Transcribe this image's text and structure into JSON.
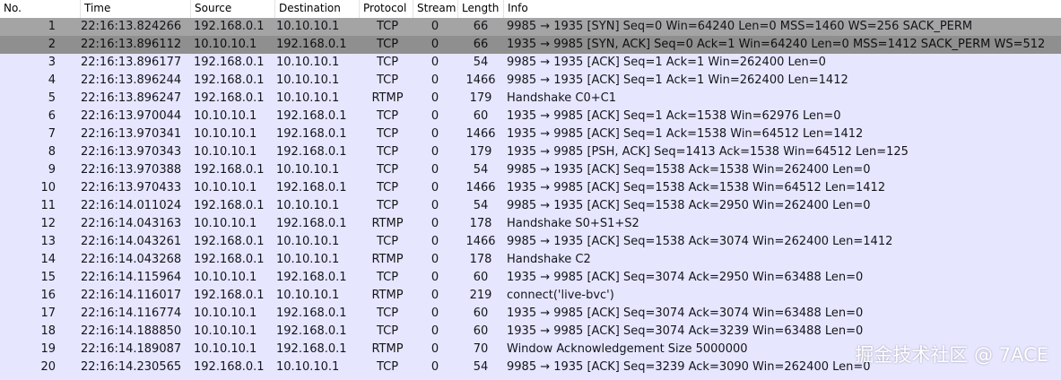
{
  "columns": {
    "no": "No.",
    "time": "Time",
    "source": "Source",
    "destination": "Destination",
    "protocol": "Protocol",
    "stream": "Stream",
    "length": "Length",
    "info": "Info"
  },
  "colors": {
    "row_background": "#e7e6ff",
    "selected_primary": "#a4a4a4",
    "selected_secondary": "#8f8f8f"
  },
  "packets": [
    {
      "no": "1",
      "time": "22:16:13.824266",
      "src": "192.168.0.1",
      "dst": "10.10.10.1",
      "proto": "TCP",
      "stream": "0",
      "len": "66",
      "info": "9985 → 1935 [SYN] Seq=0 Win=64240 Len=0 MSS=1460 WS=256 SACK_PERM"
    },
    {
      "no": "2",
      "time": "22:16:13.896112",
      "src": "10.10.10.1",
      "dst": "192.168.0.1",
      "proto": "TCP",
      "stream": "0",
      "len": "66",
      "info": "1935 → 9985 [SYN, ACK] Seq=0 Ack=1 Win=64240 Len=0 MSS=1412 SACK_PERM WS=512"
    },
    {
      "no": "3",
      "time": "22:16:13.896177",
      "src": "192.168.0.1",
      "dst": "10.10.10.1",
      "proto": "TCP",
      "stream": "0",
      "len": "54",
      "info": "9985 → 1935 [ACK] Seq=1 Ack=1 Win=262400 Len=0"
    },
    {
      "no": "4",
      "time": "22:16:13.896244",
      "src": "192.168.0.1",
      "dst": "10.10.10.1",
      "proto": "TCP",
      "stream": "0",
      "len": "1466",
      "info": "9985 → 1935 [ACK] Seq=1 Ack=1 Win=262400 Len=1412"
    },
    {
      "no": "5",
      "time": "22:16:13.896247",
      "src": "192.168.0.1",
      "dst": "10.10.10.1",
      "proto": "RTMP",
      "stream": "0",
      "len": "179",
      "info": "Handshake C0+C1"
    },
    {
      "no": "6",
      "time": "22:16:13.970044",
      "src": "10.10.10.1",
      "dst": "192.168.0.1",
      "proto": "TCP",
      "stream": "0",
      "len": "60",
      "info": "1935 → 9985 [ACK] Seq=1 Ack=1538 Win=62976 Len=0"
    },
    {
      "no": "7",
      "time": "22:16:13.970341",
      "src": "10.10.10.1",
      "dst": "192.168.0.1",
      "proto": "TCP",
      "stream": "0",
      "len": "1466",
      "info": "1935 → 9985 [ACK] Seq=1 Ack=1538 Win=64512 Len=1412"
    },
    {
      "no": "8",
      "time": "22:16:13.970343",
      "src": "10.10.10.1",
      "dst": "192.168.0.1",
      "proto": "TCP",
      "stream": "0",
      "len": "179",
      "info": "1935 → 9985 [PSH, ACK] Seq=1413 Ack=1538 Win=64512 Len=125"
    },
    {
      "no": "9",
      "time": "22:16:13.970388",
      "src": "192.168.0.1",
      "dst": "10.10.10.1",
      "proto": "TCP",
      "stream": "0",
      "len": "54",
      "info": "9985 → 1935 [ACK] Seq=1538 Ack=1538 Win=262400 Len=0"
    },
    {
      "no": "10",
      "time": "22:16:13.970433",
      "src": "10.10.10.1",
      "dst": "192.168.0.1",
      "proto": "TCP",
      "stream": "0",
      "len": "1466",
      "info": "1935 → 9985 [ACK] Seq=1538 Ack=1538 Win=64512 Len=1412"
    },
    {
      "no": "11",
      "time": "22:16:14.011024",
      "src": "192.168.0.1",
      "dst": "10.10.10.1",
      "proto": "TCP",
      "stream": "0",
      "len": "54",
      "info": "9985 → 1935 [ACK] Seq=1538 Ack=2950 Win=262400 Len=0"
    },
    {
      "no": "12",
      "time": "22:16:14.043163",
      "src": "10.10.10.1",
      "dst": "192.168.0.1",
      "proto": "RTMP",
      "stream": "0",
      "len": "178",
      "info": "Handshake S0+S1+S2"
    },
    {
      "no": "13",
      "time": "22:16:14.043261",
      "src": "192.168.0.1",
      "dst": "10.10.10.1",
      "proto": "TCP",
      "stream": "0",
      "len": "1466",
      "info": "9985 → 1935 [ACK] Seq=1538 Ack=3074 Win=262400 Len=1412"
    },
    {
      "no": "14",
      "time": "22:16:14.043268",
      "src": "192.168.0.1",
      "dst": "10.10.10.1",
      "proto": "RTMP",
      "stream": "0",
      "len": "178",
      "info": "Handshake C2"
    },
    {
      "no": "15",
      "time": "22:16:14.115964",
      "src": "10.10.10.1",
      "dst": "192.168.0.1",
      "proto": "TCP",
      "stream": "0",
      "len": "60",
      "info": "1935 → 9985 [ACK] Seq=3074 Ack=2950 Win=63488 Len=0"
    },
    {
      "no": "16",
      "time": "22:16:14.116017",
      "src": "192.168.0.1",
      "dst": "10.10.10.1",
      "proto": "RTMP",
      "stream": "0",
      "len": "219",
      "info": "connect('live-bvc')"
    },
    {
      "no": "17",
      "time": "22:16:14.116774",
      "src": "10.10.10.1",
      "dst": "192.168.0.1",
      "proto": "TCP",
      "stream": "0",
      "len": "60",
      "info": "1935 → 9985 [ACK] Seq=3074 Ack=3074 Win=63488 Len=0"
    },
    {
      "no": "18",
      "time": "22:16:14.188850",
      "src": "10.10.10.1",
      "dst": "192.168.0.1",
      "proto": "TCP",
      "stream": "0",
      "len": "60",
      "info": "1935 → 9985 [ACK] Seq=3074 Ack=3239 Win=63488 Len=0"
    },
    {
      "no": "19",
      "time": "22:16:14.189087",
      "src": "10.10.10.1",
      "dst": "192.168.0.1",
      "proto": "RTMP",
      "stream": "0",
      "len": "70",
      "info": "Window Acknowledgement Size 5000000"
    },
    {
      "no": "20",
      "time": "22:16:14.230565",
      "src": "192.168.0.1",
      "dst": "10.10.10.1",
      "proto": "TCP",
      "stream": "0",
      "len": "54",
      "info": "9985 → 1935 [ACK] Seq=3239 Ack=3090 Win=262400 Len=0"
    }
  ],
  "watermark": "掘金技术社区 @ 7ACE"
}
